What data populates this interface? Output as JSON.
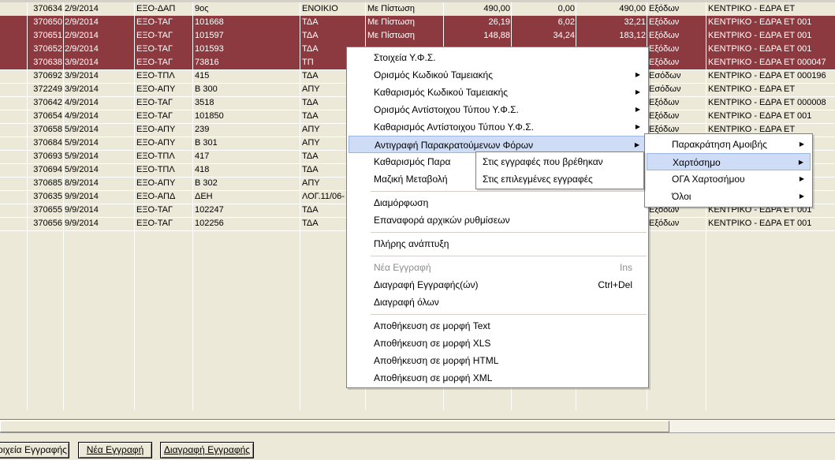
{
  "rows": [
    {
      "c0": "",
      "c1": "370634",
      "c2": "2/9/2014",
      "c3": "ΕΞΟ-ΔΑΠ",
      "c4": "9ος",
      "c5": "ΕΝΟΙΚΙΟ",
      "c6": "Με Πίστωση",
      "c7": "490,00",
      "c8": "0,00",
      "c9": "490,00",
      "c10": "Εξόδων",
      "c11": "ΚΕΝΤΡΙΚΟ - ΕΔΡΑ ΕΤ",
      "sel": false
    },
    {
      "c0": "",
      "c1": "370650",
      "c2": "2/9/2014",
      "c3": "ΕΞΟ-ΤΑΓ",
      "c4": "101668",
      "c5": "ΤΔΑ",
      "c6": "Με Πίστωση",
      "c7": "26,19",
      "c8": "6,02",
      "c9": "32,21",
      "c10": "Εξόδων",
      "c11": "ΚΕΝΤΡΙΚΟ - ΕΔΡΑ ΕΤ 001",
      "sel": true
    },
    {
      "c0": "",
      "c1": "370651",
      "c2": "2/9/2014",
      "c3": "ΕΞΟ-ΤΑΓ",
      "c4": "101597",
      "c5": "ΤΔΑ",
      "c6": "Με Πίστωση",
      "c7": "148,88",
      "c8": "34,24",
      "c9": "183,12",
      "c10": "Εξόδων",
      "c11": "ΚΕΝΤΡΙΚΟ - ΕΔΡΑ ΕΤ 001",
      "sel": true
    },
    {
      "c0": "",
      "c1": "370652",
      "c2": "2/9/2014",
      "c3": "ΕΞΟ-ΤΑΓ",
      "c4": "101593",
      "c5": "ΤΔΑ",
      "c6": "",
      "c7": "",
      "c8": "",
      "c9": "",
      "c10": "Εξόδων",
      "c11": "ΚΕΝΤΡΙΚΟ - ΕΔΡΑ ΕΤ 001",
      "sel": true
    },
    {
      "c0": "",
      "c1": "370638",
      "c2": "3/9/2014",
      "c3": "ΕΞΟ-ΤΑΓ",
      "c4": "73816",
      "c5": "ΤΠ",
      "c6": "",
      "c7": "",
      "c8": "",
      "c9": "",
      "c10": "Εξόδων",
      "c11": "ΚΕΝΤΡΙΚΟ - ΕΔΡΑ ΕΤ 000047",
      "sel": true
    },
    {
      "c0": "",
      "c1": "370692",
      "c2": "3/9/2014",
      "c3": "ΕΞΟ-ΤΠΛ",
      "c4": "415",
      "c5": "ΤΔΑ",
      "c6": "",
      "c7": "",
      "c8": "",
      "c9": "",
      "c10": "Εσόδων",
      "c11": "ΚΕΝΤΡΙΚΟ - ΕΔΡΑ ΕΤ 000196",
      "sel": false
    },
    {
      "c0": "",
      "c1": "372249",
      "c2": "3/9/2014",
      "c3": "ΕΞΟ-ΑΠΥ",
      "c4": "Β 300",
      "c5": "ΑΠΥ",
      "c6": "",
      "c7": "",
      "c8": "",
      "c9": "",
      "c10": "Εσόδων",
      "c11": "ΚΕΝΤΡΙΚΟ - ΕΔΡΑ ΕΤ",
      "sel": false
    },
    {
      "c0": "",
      "c1": "370642",
      "c2": "4/9/2014",
      "c3": "ΕΞΟ-ΤΑΓ",
      "c4": "3518",
      "c5": "ΤΔΑ",
      "c6": "",
      "c7": "",
      "c8": "",
      "c9": "",
      "c10": "Εξόδων",
      "c11": "ΚΕΝΤΡΙΚΟ - ΕΔΡΑ ΕΤ 000008",
      "sel": false
    },
    {
      "c0": "",
      "c1": "370654",
      "c2": "4/9/2014",
      "c3": "ΕΞΟ-ΤΑΓ",
      "c4": "101850",
      "c5": "ΤΔΑ",
      "c6": "",
      "c7": "",
      "c8": "",
      "c9": "",
      "c10": "Εξόδων",
      "c11": "ΚΕΝΤΡΙΚΟ - ΕΔΡΑ ΕΤ 001",
      "sel": false
    },
    {
      "c0": "",
      "c1": "370658",
      "c2": "5/9/2014",
      "c3": "ΕΞΟ-ΑΠΥ",
      "c4": "239",
      "c5": "ΑΠΥ",
      "c6": "",
      "c7": "",
      "c8": "",
      "c9": "",
      "c10": "Εξόδων",
      "c11": "ΚΕΝΤΡΙΚΟ - ΕΔΡΑ ΕΤ",
      "sel": false
    },
    {
      "c0": "",
      "c1": "370684",
      "c2": "5/9/2014",
      "c3": "ΕΞΟ-ΑΠΥ",
      "c4": "Β 301",
      "c5": "ΑΠΥ",
      "c6": "",
      "c7": "",
      "c8": "",
      "c9": "",
      "c10": "",
      "c11": "",
      "sel": false
    },
    {
      "c0": "",
      "c1": "370693",
      "c2": "5/9/2014",
      "c3": "ΕΞΟ-ΤΠΛ",
      "c4": "417",
      "c5": "ΤΔΑ",
      "c6": "",
      "c7": "",
      "c8": "",
      "c9": "",
      "c10": "",
      "c11": "",
      "sel": false
    },
    {
      "c0": "",
      "c1": "370694",
      "c2": "5/9/2014",
      "c3": "ΕΞΟ-ΤΠΛ",
      "c4": "418",
      "c5": "ΤΔΑ",
      "c6": "",
      "c7": "",
      "c8": "",
      "c9": "",
      "c10": "",
      "c11": "",
      "sel": false
    },
    {
      "c0": "",
      "c1": "370685",
      "c2": "8/9/2014",
      "c3": "ΕΞΟ-ΑΠΥ",
      "c4": "Β 302",
      "c5": "ΑΠΥ",
      "c6": "",
      "c7": "",
      "c8": "",
      "c9": "",
      "c10": "",
      "c11": "",
      "sel": false
    },
    {
      "c0": "",
      "c1": "370635",
      "c2": "9/9/2014",
      "c3": "ΕΞΟ-ΑΠΔ",
      "c4": "ΔΕΗ",
      "c5": "ΛΟΓ.11/06-",
      "c6": "",
      "c7": "",
      "c8": "",
      "c9": "",
      "c10": "",
      "c11": "",
      "sel": false
    },
    {
      "c0": "",
      "c1": "370655",
      "c2": "9/9/2014",
      "c3": "ΕΞΟ-ΤΑΓ",
      "c4": "102247",
      "c5": "ΤΔΑ",
      "c6": "",
      "c7": "",
      "c8": "",
      "c9": "",
      "c10": "Εξόδων",
      "c11": "ΚΕΝΤΡΙΚΟ - ΕΔΡΑ ΕΤ 001",
      "sel": false
    },
    {
      "c0": "",
      "c1": "370656",
      "c2": "9/9/2014",
      "c3": "ΕΞΟ-ΤΑΓ",
      "c4": "102256",
      "c5": "ΤΔΑ",
      "c6": "",
      "c7": "",
      "c8": "",
      "c9": "",
      "c10": "Εξόδων",
      "c11": "ΚΕΝΤΡΙΚΟ - ΕΔΡΑ ΕΤ 001",
      "sel": false
    }
  ],
  "buttons": {
    "details": "οιχεία Εγγραφής",
    "new": "Νέα Εγγραφή",
    "delete": "Διαγραφή Εγγραφής"
  },
  "context_menu": {
    "items": [
      {
        "label": "Στοιχεία Υ.Φ.Σ.",
        "submenu": false,
        "shortcut": "",
        "disabled": false
      },
      {
        "label": "Ορισμός Κωδικού Ταμειακής",
        "submenu": true,
        "shortcut": "",
        "disabled": false
      },
      {
        "label": "Καθαρισμός Κωδικού Ταμειακής",
        "submenu": true,
        "shortcut": "",
        "disabled": false
      },
      {
        "label": "Ορισμός Αντίστοιχου Τύπου Υ.Φ.Σ.",
        "submenu": true,
        "shortcut": "",
        "disabled": false
      },
      {
        "label": "Καθαρισμός Αντίστοιχου Τύπου Υ.Φ.Σ.",
        "submenu": true,
        "shortcut": "",
        "disabled": false
      },
      {
        "label": "Αντιγραφή Παρακρατούμενων Φόρων",
        "submenu": true,
        "shortcut": "",
        "disabled": false,
        "highlight": true
      },
      {
        "label": "Καθαρισμός Παρα",
        "submenu": false,
        "shortcut": "",
        "disabled": false
      },
      {
        "label": "Μαζική Μεταβολή",
        "submenu": false,
        "shortcut": "",
        "disabled": false
      },
      {
        "sep": true
      },
      {
        "label": "Διαμόρφωση",
        "submenu": false,
        "shortcut": "",
        "disabled": false
      },
      {
        "label": "Επαναφορά αρχικών ρυθμίσεων",
        "submenu": false,
        "shortcut": "",
        "disabled": false
      },
      {
        "sep": true
      },
      {
        "label": "Πλήρης ανάπτυξη",
        "submenu": false,
        "shortcut": "",
        "disabled": false
      },
      {
        "sep": true
      },
      {
        "label": "Νέα Εγγραφή",
        "submenu": false,
        "shortcut": "Ins",
        "disabled": true
      },
      {
        "label": "Διαγραφή Εγγραφής(ών)",
        "submenu": false,
        "shortcut": "Ctrl+Del",
        "disabled": false
      },
      {
        "label": "Διαγραφή όλων",
        "submenu": false,
        "shortcut": "",
        "disabled": false
      },
      {
        "sep": true
      },
      {
        "label": "Αποθήκευση σε μορφή Text",
        "submenu": false,
        "shortcut": "",
        "disabled": false
      },
      {
        "label": "Αποθήκευση σε μορφή XLS",
        "submenu": false,
        "shortcut": "",
        "disabled": false
      },
      {
        "label": "Αποθήκευση σε μορφή HTML",
        "submenu": false,
        "shortcut": "",
        "disabled": false
      },
      {
        "label": "Αποθήκευση σε μορφή XML",
        "submenu": false,
        "shortcut": "",
        "disabled": false
      }
    ]
  },
  "submenu_1": {
    "items": [
      {
        "label": "Παρακράτηση Αμοιβής",
        "submenu": true
      },
      {
        "label": "Χαρτόσημο",
        "submenu": true,
        "highlight": true
      },
      {
        "label": "ΟΓΑ Χαρτοσήμου",
        "submenu": true
      },
      {
        "label": "Όλοι",
        "submenu": true
      }
    ]
  },
  "submenu_2": {
    "items": [
      {
        "label": "Στις εγγραφές που βρέθηκαν"
      },
      {
        "label": "Στις επιλεγμένες εγγραφές"
      }
    ]
  },
  "colors": {
    "selected_row": "#8c3a3f",
    "menu_highlight": "#cfdcf5",
    "window_bg": "#ece9d8"
  }
}
